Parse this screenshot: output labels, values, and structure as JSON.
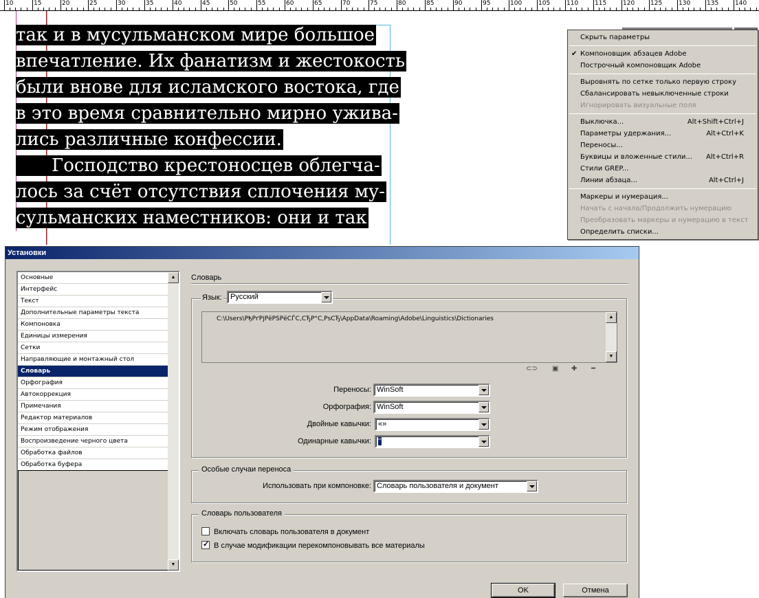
{
  "ruler": {
    "labels": [
      "10",
      "15",
      "20",
      "25",
      "30",
      "35",
      "40",
      "45",
      "50",
      "55",
      "60",
      "65",
      "70",
      "75",
      "80",
      "85",
      "90",
      "95",
      "100",
      "105",
      "110",
      "115",
      "120",
      "125",
      "130",
      "135",
      "140"
    ]
  },
  "document": {
    "lines": [
      "так и в мусульманском мире большое",
      "впечатление. Их фанатизм и жестокость",
      "были вновe для исламского востока, где",
      "в это время сравнительно мирно ужива-",
      "лись различные конфессии.",
      "  Господство крестоносцев облегча-",
      "лось за счёт отсутствия сплочения му-",
      "сульманских наместников: они и так"
    ]
  },
  "menu": {
    "hide_options": "Скрыть параметры",
    "composer_paragraph": "Компоновщик абзацев Adobe",
    "composer_single": "Построчный компоновщик Adobe",
    "align_first_line": "Выровнять по сетке только первую строку",
    "balance_ragged": "Сбалансировать невыключенные строки",
    "ignore_visual": "Игнорировать визуальные поля",
    "justification": "Выключка...",
    "justification_sc": "Alt+Shift+Ctrl+J",
    "keep_options": "Параметры удержания...",
    "keep_options_sc": "Alt+Ctrl+K",
    "hyphenation": "Переносы...",
    "drop_caps": "Буквицы и вложенные стили...",
    "drop_caps_sc": "Alt+Ctrl+R",
    "grep_styles": "Стили GREP...",
    "paragraph_rules": "Линии абзаца...",
    "paragraph_rules_sc": "Alt+Ctrl+J",
    "bullets": "Маркеры и нумерация...",
    "restart_numbering": "Начать с начала/Продолжить нумерацию",
    "convert_bullets": "Преобразовать маркеры и нумерацию в текст",
    "define_lists": "Определить списки..."
  },
  "dialog": {
    "title": "Установки",
    "categories": [
      "Основные",
      "Интерфейс",
      "Текст",
      "Дополнительные параметры текста",
      "Компоновка",
      "Единицы измерения",
      "Сетки",
      "Направляющие и монтажный стол",
      "Словарь",
      "Орфография",
      "Автокоррекция",
      "Примечания",
      "Редактор материалов",
      "Режим отображения",
      "Воспроизведение черного цвета",
      "Обработка файлов",
      "Обработка буфера"
    ],
    "selected_category": "Словарь",
    "section_title": "Словарь",
    "language_label": "Язык:",
    "language_value": "Русский",
    "dictionary_path": "C:\\Users\\РђРґРјРёРЅРёСЃС‚СЂР°С‚РѕСЂ\\AppData\\Roaming\\Adobe\\Linguistics\\Dictionaries",
    "hyphenation_label": "Переносы:",
    "hyphenation_value": "WinSoft",
    "spelling_label": "Орфография:",
    "spelling_value": "WinSoft",
    "double_quotes_label": "Двойные кавычки:",
    "double_quotes_value": "«»",
    "single_quotes_label": "Одинарные кавычки:",
    "single_quotes_value": "‘’",
    "exceptions_group": "Особые случаи переноса",
    "compose_using_label": "Использовать при компоновке:",
    "compose_using_value": "Словарь пользователя и документ",
    "user_dict_group": "Словарь пользователя",
    "include_user_dict": "Включать словарь пользователя в документ",
    "include_user_dict_checked": false,
    "recompose_stories": "В случае модификации перекомпоновывать все материалы",
    "recompose_stories_checked": true,
    "ok": "OK",
    "cancel": "Отмена"
  },
  "colors": {
    "dialog_bg": "#d4d0c8",
    "title_gradient_start": "#0a246a",
    "title_gradient_end": "#a6caf0",
    "selection": "#0a246a",
    "guide_magenta": "#c0398c",
    "guide_cyan": "#50b8d8",
    "guide_red": "#d01010"
  }
}
